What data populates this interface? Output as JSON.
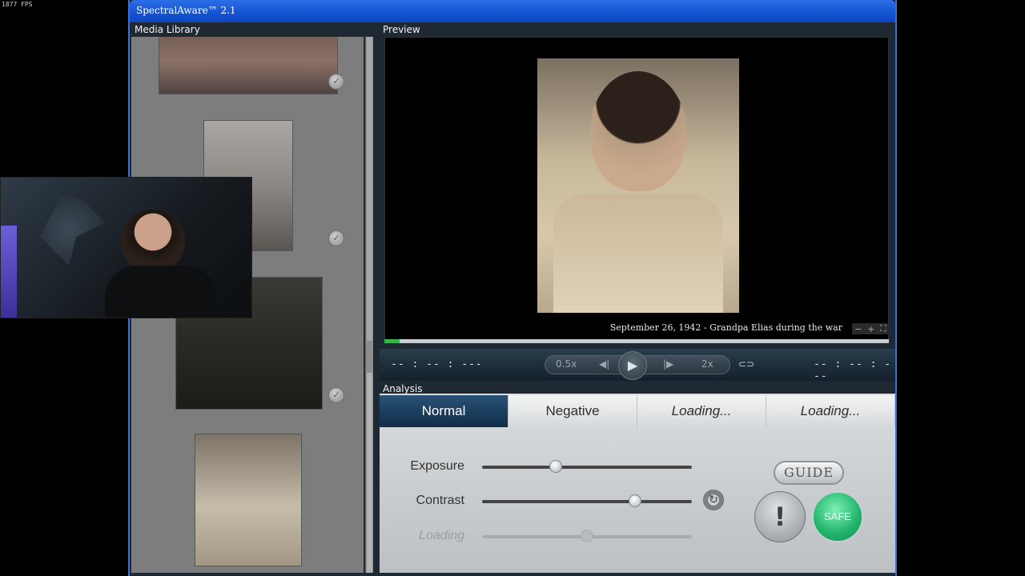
{
  "overlay": {
    "fps": "1877 FPS"
  },
  "window": {
    "title": "SpectralAware™ 2.1"
  },
  "media_library": {
    "title": "Media Library",
    "items": [
      {
        "check_icon": "checkmark-icon"
      },
      {
        "check_icon": "checkmark-icon"
      },
      {
        "check_icon": "checkmark-icon"
      },
      {
        "check_icon": "checkmark-icon"
      }
    ]
  },
  "preview": {
    "title": "Preview",
    "caption": "September 26, 1942 - Grandpa Elias during the war",
    "zoom_out": "−",
    "zoom_in": "+",
    "progress_fraction": 0.03
  },
  "transport": {
    "time_left": "-- : -- : ---",
    "time_right": "-- : -- : ---",
    "speed_slow": "0.5x",
    "speed_fast": "2x",
    "prev_symbol": "◀|",
    "play_symbol": "▶",
    "next_symbol": "|▶",
    "loop_symbol": "⊂⊃"
  },
  "analysis": {
    "title": "Analysis",
    "tabs": [
      {
        "label": "Normal"
      },
      {
        "label": "Negative"
      },
      {
        "label": "Loading..."
      },
      {
        "label": "Loading..."
      }
    ],
    "sliders": [
      {
        "label": "Exposure",
        "value": 0.35
      },
      {
        "label": "Contrast",
        "value": 0.73
      },
      {
        "label": "Loading",
        "value": 0.5
      }
    ],
    "reset_symbol": "↻",
    "guide_label": "GUIDE",
    "warn_label": "!",
    "safe_label": "SAFE"
  },
  "colors": {
    "title_bar": "#1453d2",
    "active_tab": "#102d49",
    "safe_button": "#1fb26a"
  }
}
